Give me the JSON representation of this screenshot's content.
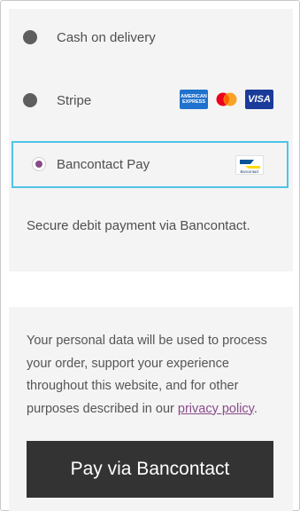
{
  "payment_methods": [
    {
      "label": "Cash on delivery",
      "selected": false,
      "icons": []
    },
    {
      "label": "Stripe",
      "selected": false,
      "icons": [
        "amex-card-icon",
        "mastercard-icon",
        "visa-card-icon"
      ]
    },
    {
      "label": "Bancontact Pay",
      "selected": true,
      "icons": [
        "bancontact-logo-icon"
      ]
    }
  ],
  "method_description": "Secure debit payment via Bancontact.",
  "cards": {
    "amex_text": "AMERICAN EXPRESS",
    "visa_text": "VISA",
    "bancontact_text": "Bancontact"
  },
  "privacy": {
    "text_before": "Your personal data will be used to process your order, support your experience throughout this website, and for other purposes described in our ",
    "link_text": "privacy policy",
    "text_after": "."
  },
  "pay_button_label": "Pay via Bancontact",
  "colors": {
    "panel_bg": "#f4f4f4",
    "selected_border": "#4fc3e8",
    "radio_selected": "#8a4b8a",
    "link": "#8a4b8a",
    "button_bg": "#333333"
  }
}
